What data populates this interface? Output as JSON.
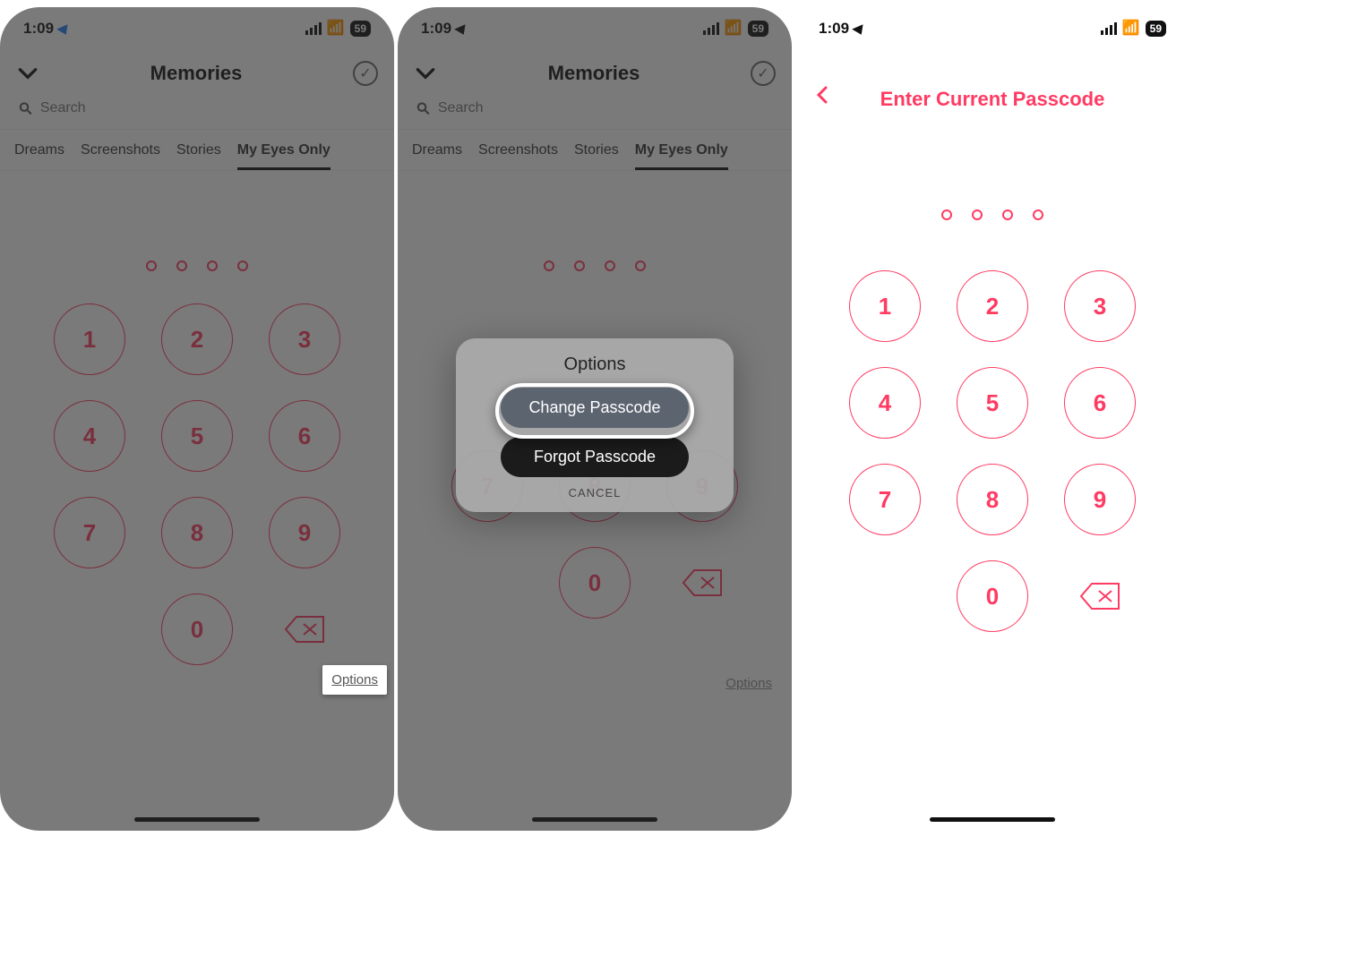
{
  "status": {
    "time": "1:09",
    "battery": "59"
  },
  "header": {
    "title": "Memories"
  },
  "search": {
    "placeholder": "Search"
  },
  "tabs": [
    "Dreams",
    "Screenshots",
    "Stories",
    "My Eyes Only"
  ],
  "keypad": [
    "1",
    "2",
    "3",
    "4",
    "5",
    "6",
    "7",
    "8",
    "9",
    "0"
  ],
  "options_label": "Options",
  "modal": {
    "title": "Options",
    "change": "Change Passcode",
    "forgot": "Forgot Passcode",
    "cancel": "CANCEL"
  },
  "screen3": {
    "title": "Enter Current Passcode"
  },
  "colors": {
    "accent": "#FF3B63"
  }
}
